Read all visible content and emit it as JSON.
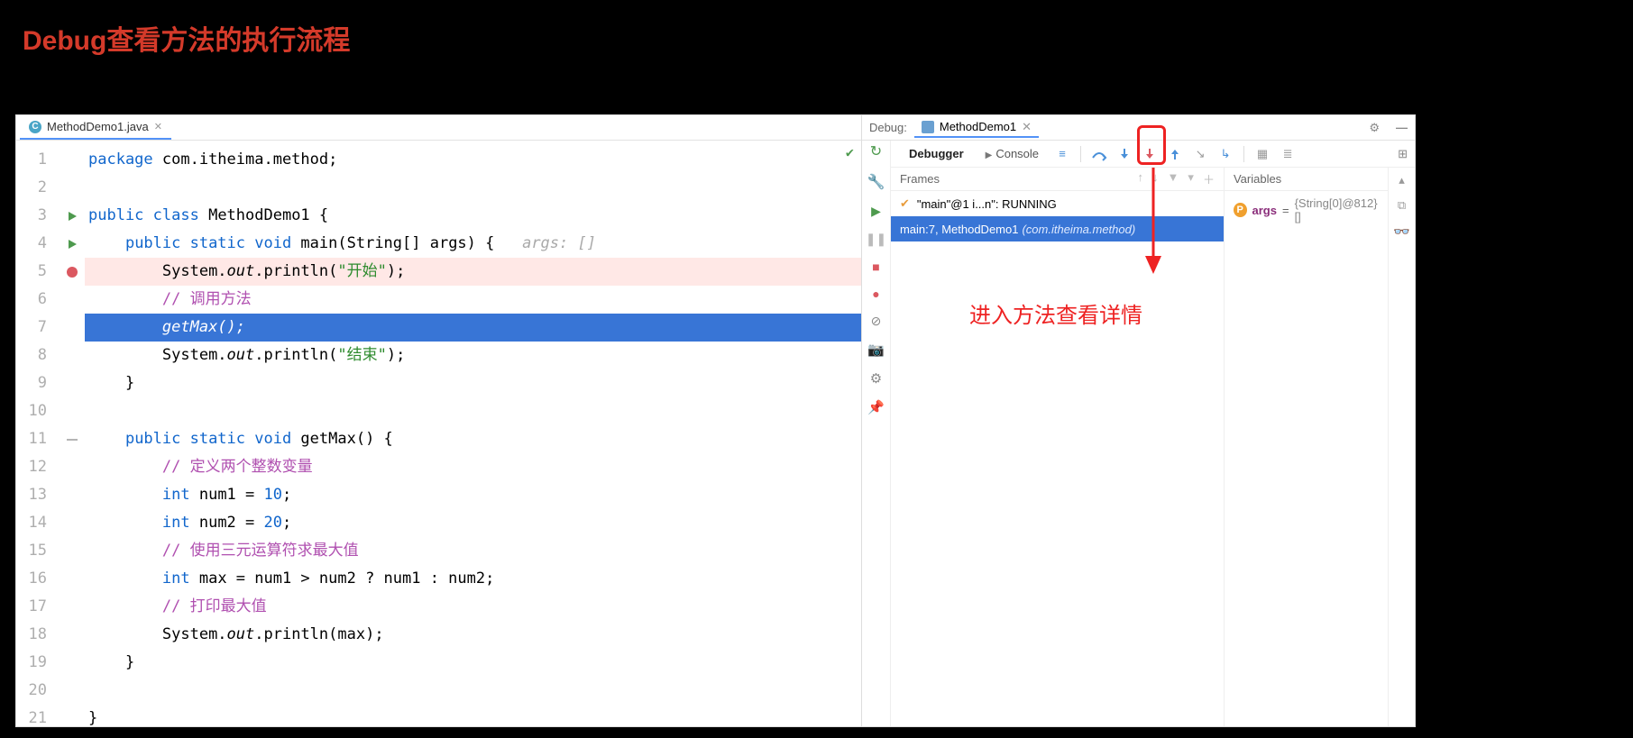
{
  "title": "Debug查看方法的执行流程",
  "editor": {
    "tab_filename": "MethodDemo1.java",
    "line_numbers": [
      "1",
      "2",
      "3",
      "4",
      "5",
      "6",
      "7",
      "8",
      "9",
      "10",
      "11",
      "12",
      "13",
      "14",
      "15",
      "16",
      "17",
      "18",
      "19",
      "20",
      "21"
    ],
    "code": {
      "l1_kw1": "package",
      "l1_rest": " com.itheima.method;",
      "l3_kw1": "public ",
      "l3_kw2": "class ",
      "l3_rest": "MethodDemo1 {",
      "l4_kw1": "public static void ",
      "l4_name": "main",
      "l4_sig": "(String[] args) {   ",
      "l4_hint": "args: []",
      "l5_a": "System.",
      "l5_out": "out",
      "l5_b": ".println(",
      "l5_str": "\"开始\"",
      "l5_c": ");",
      "l6_cmt": "// 调用方法",
      "l7": "getMax();",
      "l8_a": "System.",
      "l8_out": "out",
      "l8_b": ".println(",
      "l8_str": "\"结束\"",
      "l8_c": ");",
      "l9": "}",
      "l11_kw": "public static void ",
      "l11_name": "getMax",
      "l11_rest": "() {",
      "l12_cmt": "// 定义两个整数变量",
      "l13_kw": "int ",
      "l13_a": "num1 = ",
      "l13_lit": "10",
      "l13_b": ";",
      "l14_kw": "int ",
      "l14_a": "num2 = ",
      "l14_lit": "20",
      "l14_b": ";",
      "l15_cmt": "// 使用三元运算符求最大值",
      "l16_kw": "int ",
      "l16_rest": "max = num1 > num2 ? num1 : num2;",
      "l17_cmt": "// 打印最大值",
      "l18_a": "System.",
      "l18_out": "out",
      "l18_b": ".println(max);",
      "l19": "}",
      "l21": "}"
    }
  },
  "debug": {
    "label": "Debug:",
    "config_name": "MethodDemo1",
    "tabs": {
      "debugger": "Debugger",
      "console": "Console"
    },
    "frames_label": "Frames",
    "variables_label": "Variables",
    "thread": "\"main\"@1 i...n\": RUNNING",
    "frame_main": "main:7, MethodDemo1 ",
    "frame_pkg": "(com.itheima.method)",
    "var_name": "args",
    "var_eq": " = ",
    "var_value": "{String[0]@812} []"
  },
  "annotation": {
    "text": "进入方法查看详情"
  }
}
